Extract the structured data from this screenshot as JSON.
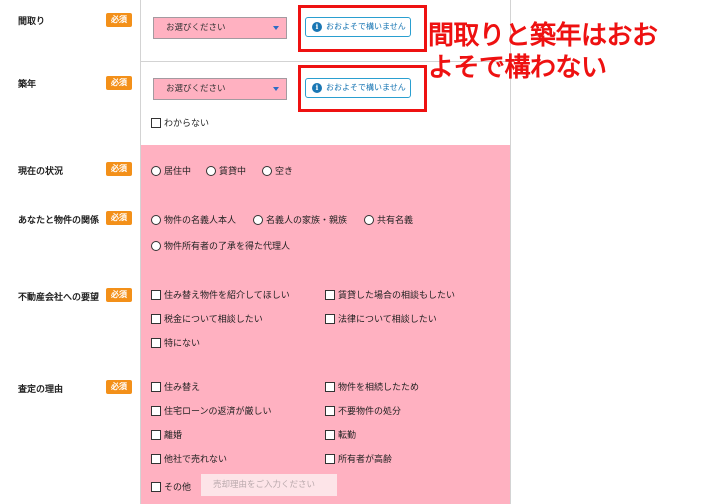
{
  "required_badge": "必須",
  "approx_button": "おおよそで構いません",
  "info_glyph": "i",
  "select_placeholder": "お選びください",
  "annotation": {
    "line1": "間取りと築年はおお",
    "line2": "よそで構わない"
  },
  "rows": {
    "layout": {
      "label": "間取り"
    },
    "built_year": {
      "label": "築年",
      "unknown": "わからない"
    },
    "status": {
      "label": "現在の状況",
      "options": [
        "居住中",
        "賃貸中",
        "空き"
      ]
    },
    "relation": {
      "label": "あなたと物件の関係",
      "options": [
        "物件の名義人本人",
        "名義人の家族・親族",
        "共有名義",
        "物件所有者の了承を得た代理人"
      ]
    },
    "request": {
      "label": "不動産会社への要望",
      "options": [
        "住み替え物件を紹介してほしい",
        "賃貸した場合の相談もしたい",
        "税金について相談したい",
        "法律について相談したい",
        "特にない"
      ]
    },
    "reason": {
      "label": "査定の理由",
      "options": [
        "住み替え",
        "物件を相続したため",
        "住宅ローンの返済が厳しい",
        "不要物件の処分",
        "離婚",
        "転勤",
        "他社で売れない",
        "所有者が高齢",
        "その他"
      ],
      "other_placeholder": "売却理由をご入力ください"
    }
  }
}
